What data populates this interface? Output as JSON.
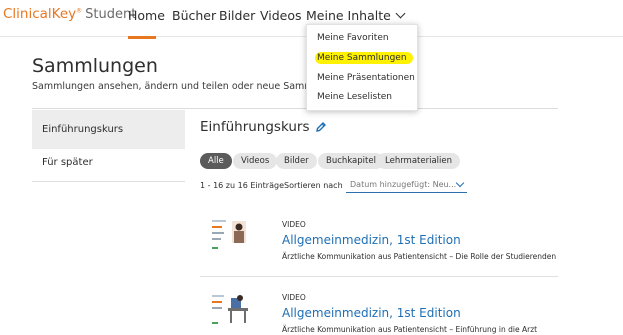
{
  "header": {
    "brand": "ClinicalKey",
    "brand_mark": "®",
    "brand_suffix": "Student",
    "nav": [
      "Home",
      "Bücher",
      "Bilder",
      "Videos",
      "Meine Inhalte"
    ],
    "accent_color": "#e87722"
  },
  "dropdown": {
    "items": [
      "Meine Favoriten",
      "Meine Sammlungen",
      "Meine Präsentationen",
      "Meine Leselisten"
    ],
    "highlighted_index": 1
  },
  "page": {
    "title": "Sammlungen",
    "subtitle": "Sammlungen ansehen, ändern und teilen oder neue Sammlungen e"
  },
  "sidebar": {
    "items": [
      {
        "label": "Einführungskurs",
        "active": true
      },
      {
        "label": "Für später",
        "active": false
      }
    ]
  },
  "collection": {
    "title": "Einführungskurs",
    "filters": [
      "Alle",
      "Videos",
      "Bilder",
      "Buchkapitel",
      "Lehrmaterialien"
    ],
    "active_filter": "Alle",
    "count": "1 - 16 zu 16 Einträge",
    "sort_label": "Sortieren nach",
    "sort_value": "Datum hinzugefügt: Neu...",
    "items": [
      {
        "type": "VIDEO",
        "title": "Allgemeinmedizin, 1st Edition",
        "desc": "Ärztliche Kommunikation aus Patientensicht – Die Rolle der Studierenden"
      },
      {
        "type": "VIDEO",
        "title": "Allgemeinmedizin, 1st Edition",
        "desc": "Ärztliche Kommunikation aus Patientensicht – Einführung in die Arzt"
      }
    ]
  }
}
